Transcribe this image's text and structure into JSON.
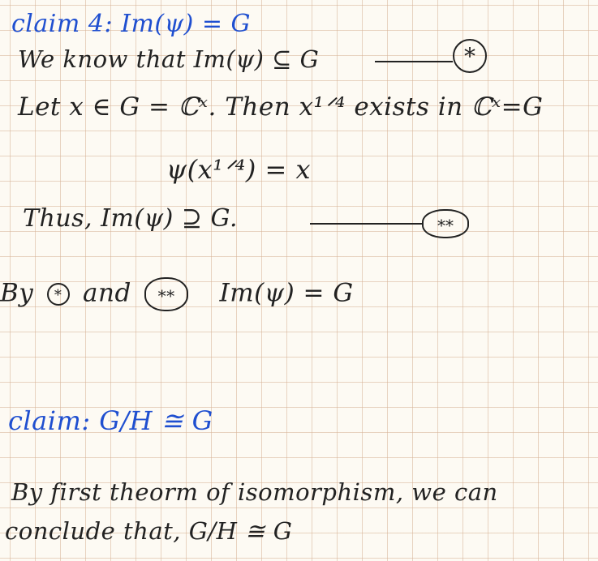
{
  "lines": {
    "l1": "claim 4: Im(ψ) = G",
    "l2_text": "We know that   Im(ψ) ⊆ G",
    "l3": "Let   x ∈ G = ℂˣ. Then  x¹ᐟ⁴  exists in ℂˣ=G",
    "l4": "ψ(x¹ᐟ⁴) = x",
    "l5_text": "Thus,   Im(ψ) ⊇ G.",
    "l6_by": "By",
    "l6_and": "and",
    "l6_tail": "Im(ψ) = G",
    "l7": "claim:  G/H ≅ G",
    "l8": "By first theorm of isomorphism, we can",
    "l9": "conclude that,  G/H ≅ G"
  },
  "marks": {
    "star": "*",
    "double_star": "**"
  },
  "colors": {
    "ink_blue": "#1f4fd0",
    "ink_dark": "#222222",
    "paper": "#fdfaf3",
    "grid": "#d6b296"
  }
}
